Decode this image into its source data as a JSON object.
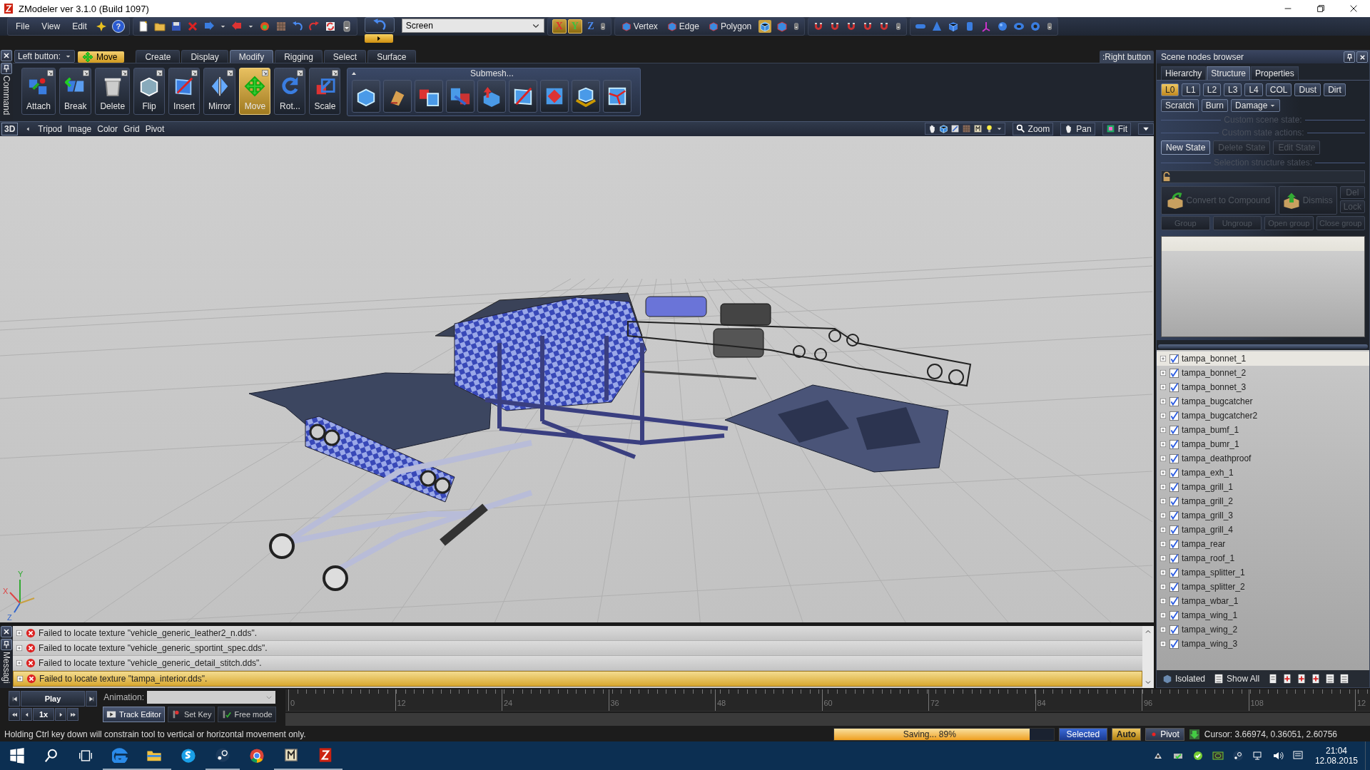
{
  "window": {
    "title": "ZModeler ver 3.1.0 (Build 1097)"
  },
  "menu": [
    "File",
    "View",
    "Edit"
  ],
  "help_button": "?",
  "toolbar": {
    "view_space": "Screen",
    "axes": [
      {
        "label": "X",
        "selected": true
      },
      {
        "label": "Y",
        "selected": true
      },
      {
        "label": "Z",
        "selected": false
      }
    ],
    "selection_modes": [
      "Vertex",
      "Edge",
      "Polygon"
    ]
  },
  "command_panel": {
    "label": "Command",
    "left_button_label": "Left button:",
    "left_button_tool": "Move",
    "right_button": ":Right button",
    "tabs": [
      {
        "label": "Create",
        "selected": false
      },
      {
        "label": "Display",
        "selected": false
      },
      {
        "label": "Modify",
        "selected": true
      },
      {
        "label": "Rigging",
        "selected": false
      },
      {
        "label": "Select",
        "selected": false
      },
      {
        "label": "Surface",
        "selected": false
      }
    ],
    "tools": [
      {
        "label": "Attach",
        "selected": false
      },
      {
        "label": "Break",
        "selected": false
      },
      {
        "label": "Delete",
        "selected": false
      },
      {
        "label": "Flip",
        "selected": false
      },
      {
        "label": "Insert",
        "selected": false
      },
      {
        "label": "Mirror",
        "selected": false
      },
      {
        "label": "Move",
        "selected": true
      },
      {
        "label": "Rot...",
        "selected": false
      },
      {
        "label": "Scale",
        "selected": false
      }
    ],
    "submesh_title": "Submesh..."
  },
  "viewport_bar": {
    "mode": "3D",
    "items": [
      "Tripod",
      "Image",
      "Color",
      "Grid",
      "Pivot"
    ],
    "nav": [
      "Zoom",
      "Pan",
      "Fit"
    ]
  },
  "viewport": {
    "axis_labels": [
      "Y",
      "X",
      "Z"
    ]
  },
  "scene_browser": {
    "title": "Scene nodes browser",
    "tabs": [
      {
        "label": "Hierarchy",
        "selected": false
      },
      {
        "label": "Structure",
        "selected": true
      },
      {
        "label": "Properties",
        "selected": false
      }
    ],
    "levels": [
      {
        "label": "L0",
        "selected": true
      },
      {
        "label": "L1",
        "selected": false
      },
      {
        "label": "L2",
        "selected": false
      },
      {
        "label": "L3",
        "selected": false
      },
      {
        "label": "L4",
        "selected": false
      },
      {
        "label": "COL",
        "selected": false
      },
      {
        "label": "Dust",
        "selected": false
      },
      {
        "label": "Dirt",
        "selected": false
      },
      {
        "label": "Scratch",
        "selected": false
      },
      {
        "label": "Burn",
        "selected": false
      },
      {
        "label": "Damage",
        "selected": false
      }
    ],
    "section_scene": "Custom scene state:",
    "section_actions": "Custom state actions:",
    "state_buttons": [
      {
        "label": "New State",
        "disabled": false
      },
      {
        "label": "Delete State",
        "disabled": true
      },
      {
        "label": "Edit State",
        "disabled": true
      }
    ],
    "section_selection": "Selection structure states:",
    "convert_button": "Convert to Compound",
    "dismiss_button": "Dismiss",
    "del_button": "Del",
    "lock_button": "Lock",
    "group_buttons": [
      "Group",
      "Ungroup",
      "Open group",
      "Close group"
    ],
    "nodes": [
      {
        "name": "tampa_bonnet_1",
        "checked": true,
        "selected": true
      },
      {
        "name": "tampa_bonnet_2",
        "checked": true,
        "selected": false
      },
      {
        "name": "tampa_bonnet_3",
        "checked": true,
        "selected": false
      },
      {
        "name": "tampa_bugcatcher",
        "checked": true,
        "selected": false
      },
      {
        "name": "tampa_bugcatcher2",
        "checked": true,
        "selected": false
      },
      {
        "name": "tampa_bumf_1",
        "checked": true,
        "selected": false
      },
      {
        "name": "tampa_bumr_1",
        "checked": true,
        "selected": false
      },
      {
        "name": "tampa_deathproof",
        "checked": true,
        "selected": false
      },
      {
        "name": "tampa_exh_1",
        "checked": true,
        "selected": false
      },
      {
        "name": "tampa_grill_1",
        "checked": true,
        "selected": false
      },
      {
        "name": "tampa_grill_2",
        "checked": true,
        "selected": false
      },
      {
        "name": "tampa_grill_3",
        "checked": true,
        "selected": false
      },
      {
        "name": "tampa_grill_4",
        "checked": true,
        "selected": false
      },
      {
        "name": "tampa_rear",
        "checked": true,
        "selected": false
      },
      {
        "name": "tampa_roof_1",
        "checked": true,
        "selected": false
      },
      {
        "name": "tampa_splitter_1",
        "checked": true,
        "selected": false
      },
      {
        "name": "tampa_splitter_2",
        "checked": true,
        "selected": false
      },
      {
        "name": "tampa_wbar_1",
        "checked": true,
        "selected": false
      },
      {
        "name": "tampa_wing_1",
        "checked": true,
        "selected": false
      },
      {
        "name": "tampa_wing_2",
        "checked": true,
        "selected": false
      },
      {
        "name": "tampa_wing_3",
        "checked": true,
        "selected": false
      }
    ],
    "footer": [
      "Isolated",
      "Show All"
    ]
  },
  "messages": {
    "label": "Messagi",
    "rows": [
      {
        "text": "Failed to locate texture \"vehicle_generic_leather2_n.dds\".",
        "selected": false
      },
      {
        "text": "Failed to locate texture \"vehicle_generic_sportint_spec.dds\".",
        "selected": false
      },
      {
        "text": "Failed to locate texture \"vehicle_generic_detail_stitch.dds\".",
        "selected": false
      },
      {
        "text": "Failed to locate texture \"tampa_interior.dds\".",
        "selected": true
      }
    ]
  },
  "animation": {
    "play": "Play",
    "speed": "1x",
    "label": "Animation:",
    "buttons": [
      "Track Editor",
      "Set Key",
      "Free mode"
    ],
    "ticks": [
      "0",
      "12",
      "24",
      "36",
      "48",
      "60",
      "72",
      "84",
      "96",
      "108",
      "12"
    ]
  },
  "status_bar": {
    "hint": "Holding Ctrl key down will constrain tool to vertical or horizontal movement only.",
    "progress": {
      "label": "Saving... 89%",
      "level": 0.89
    },
    "selected": "Selected",
    "auto": "Auto",
    "pivot": "Pivot",
    "cursor": "Cursor: 3.66974, 0.36051, 2.60756"
  },
  "taskbar": {
    "time": "21:04",
    "date": "12.08.2015"
  }
}
